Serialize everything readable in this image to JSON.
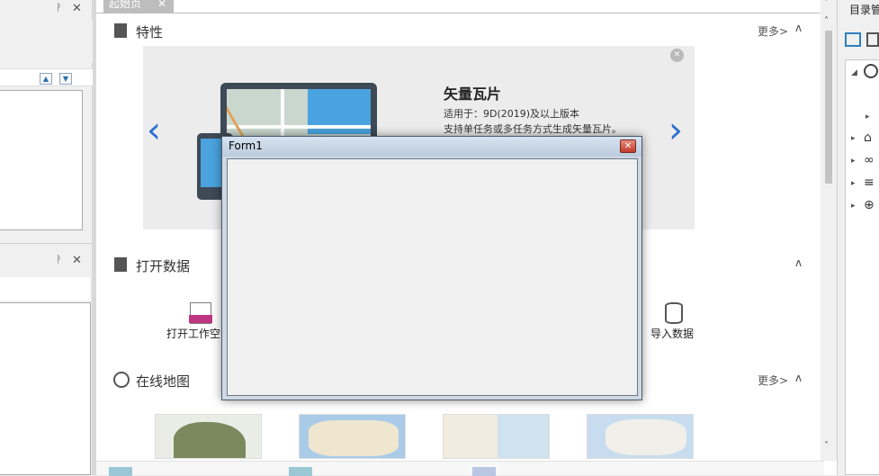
{
  "left_panel": {
    "panel1_pin": "ᚹ",
    "panel1_close": "✕",
    "panel2_pin": "ᚹ",
    "panel2_close": "✕",
    "spin_up": "▲",
    "spin_down": "▼"
  },
  "document": {
    "tab_label": "起始页",
    "tab_close": "✕",
    "features": {
      "title": "特性",
      "more": "更多>",
      "collapse": "ʌ",
      "banner": {
        "heading": "矢量瓦片",
        "line1": "适用于：9D(2019)及以上版本",
        "line2": "支持单任务或多任务方式生成矢量瓦片。",
        "close": "✕",
        "prev": "‹",
        "next": "›"
      }
    },
    "open_data": {
      "title": "打开数据",
      "collapse": "ʌ",
      "items": [
        {
          "label": "打开工作空间",
          "icon": "smwu-file-icon"
        },
        {
          "label": "导入数据",
          "icon": "database-import-icon"
        }
      ]
    },
    "online_map": {
      "title": "在线地图",
      "more": "更多>",
      "collapse": "ʌ"
    }
  },
  "right_panel": {
    "title": "目录管理"
  },
  "dialog": {
    "title": "Form1",
    "close": "✕"
  }
}
